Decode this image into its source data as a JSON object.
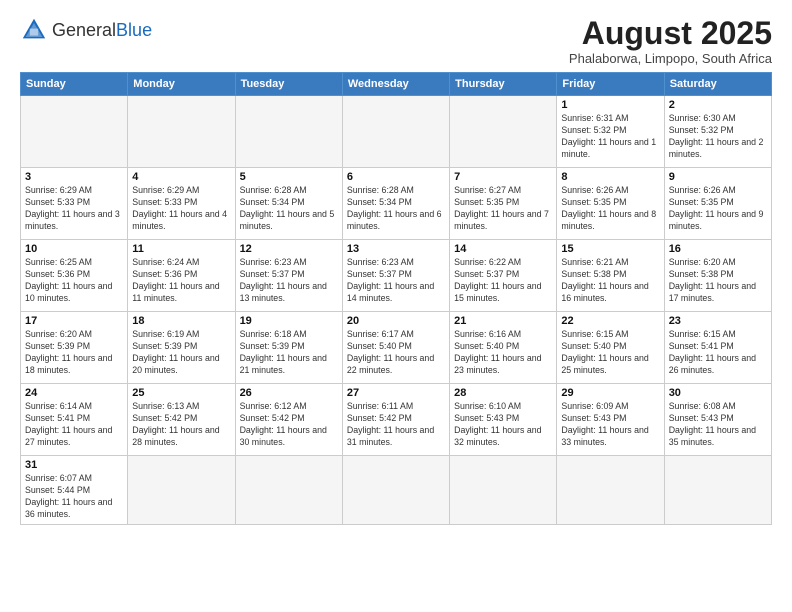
{
  "logo": {
    "text_general": "General",
    "text_blue": "Blue"
  },
  "header": {
    "month_year": "August 2025",
    "location": "Phalaborwa, Limpopo, South Africa"
  },
  "weekdays": [
    "Sunday",
    "Monday",
    "Tuesday",
    "Wednesday",
    "Thursday",
    "Friday",
    "Saturday"
  ],
  "weeks": [
    [
      {
        "day": "",
        "info": ""
      },
      {
        "day": "",
        "info": ""
      },
      {
        "day": "",
        "info": ""
      },
      {
        "day": "",
        "info": ""
      },
      {
        "day": "",
        "info": ""
      },
      {
        "day": "1",
        "info": "Sunrise: 6:31 AM\nSunset: 5:32 PM\nDaylight: 11 hours and 1 minute."
      },
      {
        "day": "2",
        "info": "Sunrise: 6:30 AM\nSunset: 5:32 PM\nDaylight: 11 hours and 2 minutes."
      }
    ],
    [
      {
        "day": "3",
        "info": "Sunrise: 6:29 AM\nSunset: 5:33 PM\nDaylight: 11 hours and 3 minutes."
      },
      {
        "day": "4",
        "info": "Sunrise: 6:29 AM\nSunset: 5:33 PM\nDaylight: 11 hours and 4 minutes."
      },
      {
        "day": "5",
        "info": "Sunrise: 6:28 AM\nSunset: 5:34 PM\nDaylight: 11 hours and 5 minutes."
      },
      {
        "day": "6",
        "info": "Sunrise: 6:28 AM\nSunset: 5:34 PM\nDaylight: 11 hours and 6 minutes."
      },
      {
        "day": "7",
        "info": "Sunrise: 6:27 AM\nSunset: 5:35 PM\nDaylight: 11 hours and 7 minutes."
      },
      {
        "day": "8",
        "info": "Sunrise: 6:26 AM\nSunset: 5:35 PM\nDaylight: 11 hours and 8 minutes."
      },
      {
        "day": "9",
        "info": "Sunrise: 6:26 AM\nSunset: 5:35 PM\nDaylight: 11 hours and 9 minutes."
      }
    ],
    [
      {
        "day": "10",
        "info": "Sunrise: 6:25 AM\nSunset: 5:36 PM\nDaylight: 11 hours and 10 minutes."
      },
      {
        "day": "11",
        "info": "Sunrise: 6:24 AM\nSunset: 5:36 PM\nDaylight: 11 hours and 11 minutes."
      },
      {
        "day": "12",
        "info": "Sunrise: 6:23 AM\nSunset: 5:37 PM\nDaylight: 11 hours and 13 minutes."
      },
      {
        "day": "13",
        "info": "Sunrise: 6:23 AM\nSunset: 5:37 PM\nDaylight: 11 hours and 14 minutes."
      },
      {
        "day": "14",
        "info": "Sunrise: 6:22 AM\nSunset: 5:37 PM\nDaylight: 11 hours and 15 minutes."
      },
      {
        "day": "15",
        "info": "Sunrise: 6:21 AM\nSunset: 5:38 PM\nDaylight: 11 hours and 16 minutes."
      },
      {
        "day": "16",
        "info": "Sunrise: 6:20 AM\nSunset: 5:38 PM\nDaylight: 11 hours and 17 minutes."
      }
    ],
    [
      {
        "day": "17",
        "info": "Sunrise: 6:20 AM\nSunset: 5:39 PM\nDaylight: 11 hours and 18 minutes."
      },
      {
        "day": "18",
        "info": "Sunrise: 6:19 AM\nSunset: 5:39 PM\nDaylight: 11 hours and 20 minutes."
      },
      {
        "day": "19",
        "info": "Sunrise: 6:18 AM\nSunset: 5:39 PM\nDaylight: 11 hours and 21 minutes."
      },
      {
        "day": "20",
        "info": "Sunrise: 6:17 AM\nSunset: 5:40 PM\nDaylight: 11 hours and 22 minutes."
      },
      {
        "day": "21",
        "info": "Sunrise: 6:16 AM\nSunset: 5:40 PM\nDaylight: 11 hours and 23 minutes."
      },
      {
        "day": "22",
        "info": "Sunrise: 6:15 AM\nSunset: 5:40 PM\nDaylight: 11 hours and 25 minutes."
      },
      {
        "day": "23",
        "info": "Sunrise: 6:15 AM\nSunset: 5:41 PM\nDaylight: 11 hours and 26 minutes."
      }
    ],
    [
      {
        "day": "24",
        "info": "Sunrise: 6:14 AM\nSunset: 5:41 PM\nDaylight: 11 hours and 27 minutes."
      },
      {
        "day": "25",
        "info": "Sunrise: 6:13 AM\nSunset: 5:42 PM\nDaylight: 11 hours and 28 minutes."
      },
      {
        "day": "26",
        "info": "Sunrise: 6:12 AM\nSunset: 5:42 PM\nDaylight: 11 hours and 30 minutes."
      },
      {
        "day": "27",
        "info": "Sunrise: 6:11 AM\nSunset: 5:42 PM\nDaylight: 11 hours and 31 minutes."
      },
      {
        "day": "28",
        "info": "Sunrise: 6:10 AM\nSunset: 5:43 PM\nDaylight: 11 hours and 32 minutes."
      },
      {
        "day": "29",
        "info": "Sunrise: 6:09 AM\nSunset: 5:43 PM\nDaylight: 11 hours and 33 minutes."
      },
      {
        "day": "30",
        "info": "Sunrise: 6:08 AM\nSunset: 5:43 PM\nDaylight: 11 hours and 35 minutes."
      }
    ],
    [
      {
        "day": "31",
        "info": "Sunrise: 6:07 AM\nSunset: 5:44 PM\nDaylight: 11 hours and 36 minutes."
      },
      {
        "day": "",
        "info": ""
      },
      {
        "day": "",
        "info": ""
      },
      {
        "day": "",
        "info": ""
      },
      {
        "day": "",
        "info": ""
      },
      {
        "day": "",
        "info": ""
      },
      {
        "day": "",
        "info": ""
      }
    ]
  ]
}
